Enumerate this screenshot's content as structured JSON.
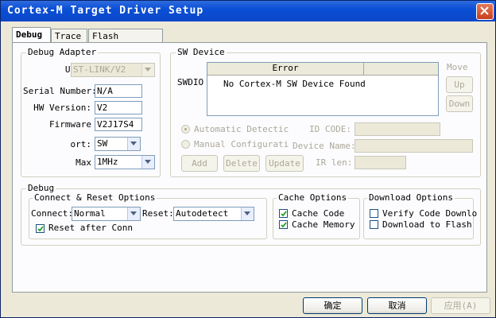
{
  "window": {
    "title": "Cortex-M Target Driver Setup"
  },
  "tabs": [
    {
      "label": "Debug",
      "active": true
    },
    {
      "label": "Trace",
      "active": false
    },
    {
      "label": "Flash Download",
      "active": false
    }
  ],
  "debug_adapter": {
    "title": "Debug Adapter",
    "unit_label": "Unit:",
    "unit_value": "ST-LINK/V2",
    "serial_label": "Serial Number:",
    "serial_value": "N/A",
    "hw_label": "HW Version:",
    "hw_value": "V2",
    "firmware_label": "Firmware",
    "firmware_value": "V2J17S4",
    "port_label": "ort:",
    "port_value": "SW",
    "max_label": "Max",
    "max_value": "1MHz"
  },
  "sw_device": {
    "title": "SW Device",
    "swdio_label": "SWDIO",
    "col_error": "Error",
    "row_text": "No Cortex-M SW Device Found",
    "move_label": "Move",
    "up_label": "Up",
    "down_label": "Down",
    "auto_label": "Automatic Detectic",
    "manual_label": "Manual Configurati",
    "idcode_label": "ID CODE:",
    "devname_label": "Device Name:",
    "irlen_label": "IR len:",
    "add_label": "Add",
    "delete_label": "Delete",
    "update_label": "Update"
  },
  "debug": {
    "title": "Debug",
    "connect_reset": {
      "title": "Connect & Reset Options",
      "connect_label": "Connect:",
      "connect_value": "Normal",
      "reset_label": "Reset:",
      "reset_value": "Autodetect",
      "reset_after_label": "Reset after Conn",
      "reset_after_checked": true
    },
    "cache": {
      "title": "Cache Options",
      "cache_code_label": "Cache Code",
      "cache_code_checked": true,
      "cache_memory_label": "Cache Memory",
      "cache_memory_checked": true
    },
    "download": {
      "title": "Download Options",
      "verify_label": "Verify Code Downlo",
      "verify_checked": false,
      "download_flash_label": "Download to Flash",
      "download_flash_checked": false
    }
  },
  "footer": {
    "ok_label": "确定",
    "cancel_label": "取消",
    "apply_label": "应用(A)"
  }
}
